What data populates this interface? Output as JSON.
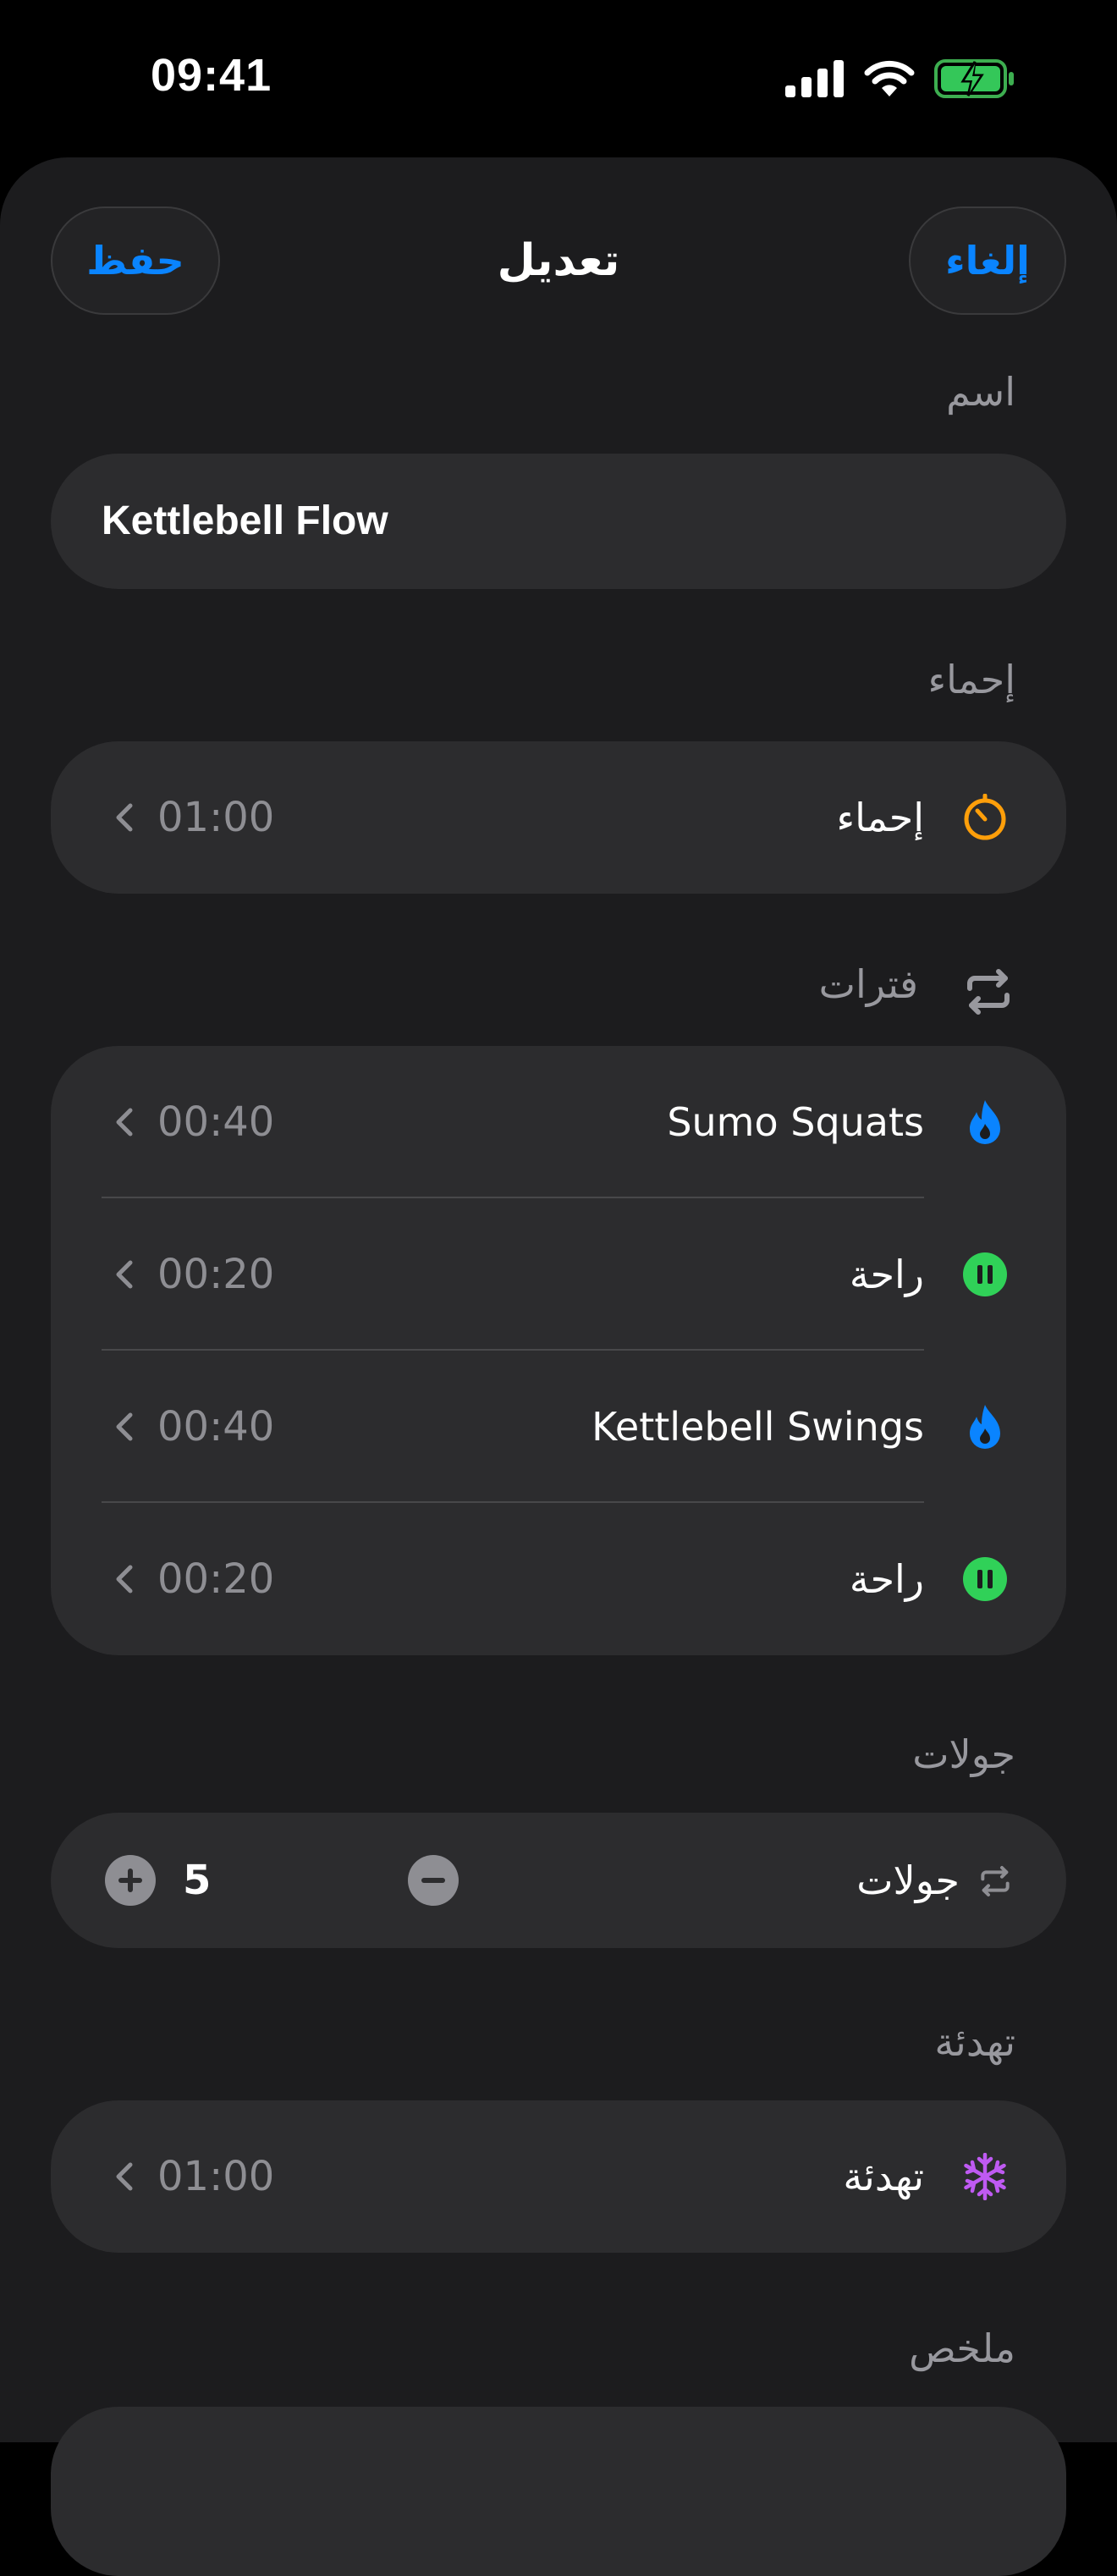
{
  "status_bar": {
    "time": "09:41"
  },
  "nav": {
    "title": "تعديل",
    "save_label": "حفظ",
    "cancel_label": "إلغاء"
  },
  "name_section": {
    "label": "اسم",
    "value": "Kettlebell Flow"
  },
  "warmup_section": {
    "label": "إحماء",
    "row": {
      "title": "إحماء",
      "time": "01:00",
      "icon": "timer-icon"
    }
  },
  "intervals_section": {
    "label": "فترات",
    "icon": "repeat-icon",
    "items": [
      {
        "title": "Sumo Squats",
        "time": "00:40",
        "icon": "flame-icon"
      },
      {
        "title": "راحة",
        "time": "00:20",
        "icon": "pause-icon"
      },
      {
        "title": "Kettlebell Swings",
        "time": "00:40",
        "icon": "flame-icon"
      },
      {
        "title": "راحة",
        "time": "00:20",
        "icon": "pause-icon"
      }
    ]
  },
  "rounds_section": {
    "label": "جولات",
    "row": {
      "title": "جولات",
      "value": "5",
      "icon": "repeat-icon"
    }
  },
  "cooldown_section": {
    "label": "تهدئة",
    "row": {
      "title": "تهدئة",
      "time": "01:00",
      "icon": "snowflake-icon"
    }
  },
  "summary_section": {
    "label": "ملخص"
  },
  "colors": {
    "accent": "#0a84ff",
    "warmup": "#ff9f0a",
    "work": "#0a84ff",
    "rest": "#30d158",
    "cooldown": "#bf5af2",
    "background": "#1c1c1e",
    "card": "#2c2c2e"
  }
}
